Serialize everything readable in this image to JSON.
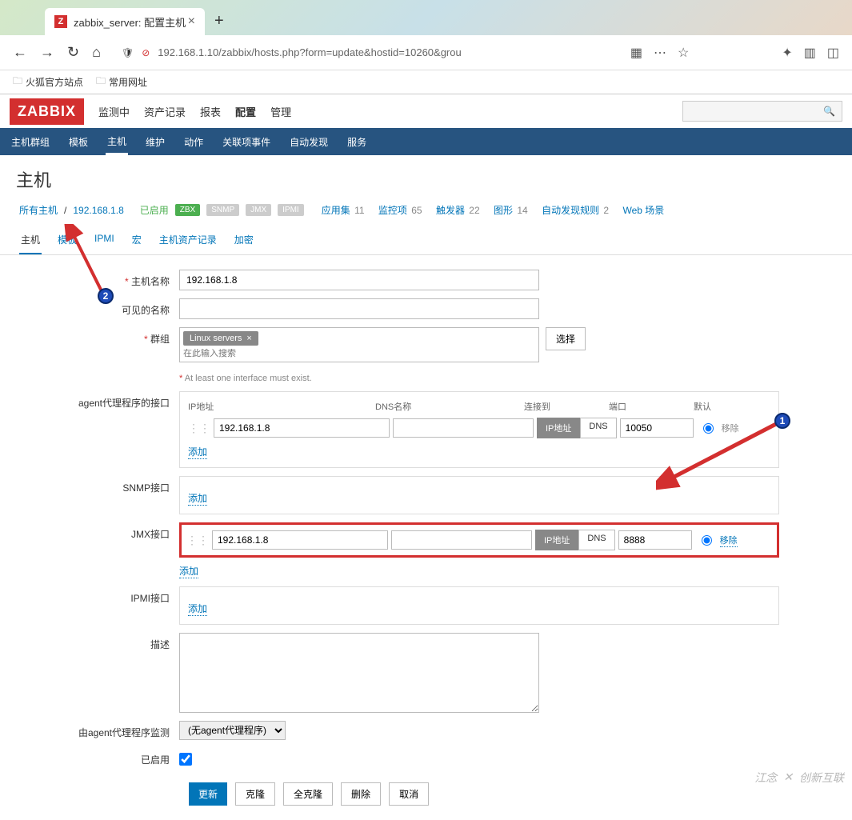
{
  "browser": {
    "tab_title": "zabbix_server: 配置主机",
    "url": "192.168.1.10/zabbix/hosts.php?form=update&hostid=10260&grou",
    "bookmarks": [
      {
        "label": "火狐官方站点"
      },
      {
        "label": "常用网址"
      }
    ]
  },
  "header": {
    "logo": "ZABBIX",
    "main_nav": [
      "监测中",
      "资产记录",
      "报表",
      "配置",
      "管理"
    ],
    "main_nav_active": 3,
    "sub_nav": [
      "主机群组",
      "模板",
      "主机",
      "维护",
      "动作",
      "关联项事件",
      "自动发现",
      "服务"
    ],
    "sub_nav_active": 2
  },
  "page": {
    "title": "主机",
    "breadcrumb": {
      "all_hosts": "所有主机",
      "host": "192.168.1.8"
    },
    "status": "已启用",
    "badges": [
      "ZBX",
      "SNMP",
      "JMX",
      "IPMI"
    ],
    "counts": [
      {
        "label": "应用集",
        "n": "11"
      },
      {
        "label": "监控项",
        "n": "65"
      },
      {
        "label": "触发器",
        "n": "22"
      },
      {
        "label": "图形",
        "n": "14"
      },
      {
        "label": "自动发现规则",
        "n": "2"
      },
      {
        "label": "Web 场景",
        "n": ""
      }
    ],
    "tabs": [
      "主机",
      "模板",
      "IPMI",
      "宏",
      "主机资产记录",
      "加密"
    ],
    "tabs_active": 0
  },
  "form": {
    "host_name_label": "主机名称",
    "host_name_value": "192.168.1.8",
    "visible_name_label": "可见的名称",
    "groups_label": "群组",
    "group_tag": "Linux servers",
    "group_placeholder": "在此输入搜索",
    "select_btn": "选择",
    "iface_note": "At least one interface must exist.",
    "agent_iface_label": "agent代理程序的接口",
    "hdr_ip": "IP地址",
    "hdr_dns": "DNS名称",
    "hdr_conn": "连接到",
    "hdr_port": "端口",
    "hdr_default": "默认",
    "agent_ip": "192.168.1.8",
    "agent_port": "10050",
    "toggle_ip": "IP地址",
    "toggle_dns": "DNS",
    "remove": "移除",
    "add": "添加",
    "snmp_label": "SNMP接口",
    "jmx_label": "JMX接口",
    "jmx_ip": "192.168.1.8",
    "jmx_port": "8888",
    "ipmi_label": "IPMI接口",
    "desc_label": "描述",
    "monitored_by_label": "由agent代理程序监测",
    "monitored_by_value": "(无agent代理程序)",
    "enabled_label": "已启用",
    "btn_update": "更新",
    "btn_clone": "克隆",
    "btn_full_clone": "全克隆",
    "btn_delete": "删除",
    "btn_cancel": "取消"
  },
  "watermark": {
    "text1": "江念",
    "text2": "创新互联"
  }
}
